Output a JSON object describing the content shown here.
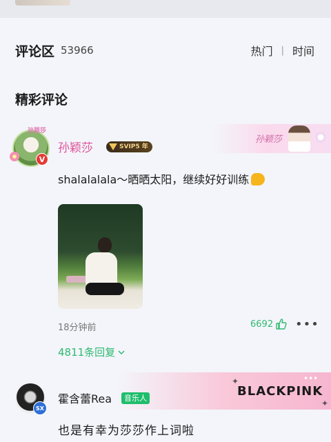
{
  "section": {
    "title": "评论区",
    "count": "53966"
  },
  "sort": {
    "hot": "热门",
    "time": "时间"
  },
  "featured_title": "精彩评论",
  "comment1": {
    "username": "孙颖莎",
    "vip_badge": "SVIP5 年",
    "avatar_tag": "孙颖莎",
    "vbadge": "V",
    "banner_text": "孙颖莎",
    "text": "shalalalala～晒晒太阳，继续好好训练",
    "time": "18分钟前",
    "likes": "6692",
    "replies": "4811条回复"
  },
  "comment2": {
    "username": "霍含蕾Rea",
    "badge": "音乐人",
    "sx_badge": "SX",
    "banner_text": "BLACKPINK",
    "text": "也是有幸为莎莎作上词啦"
  },
  "colors": {
    "accent_green": "#2fb970",
    "name_pink": "#e0529a"
  }
}
